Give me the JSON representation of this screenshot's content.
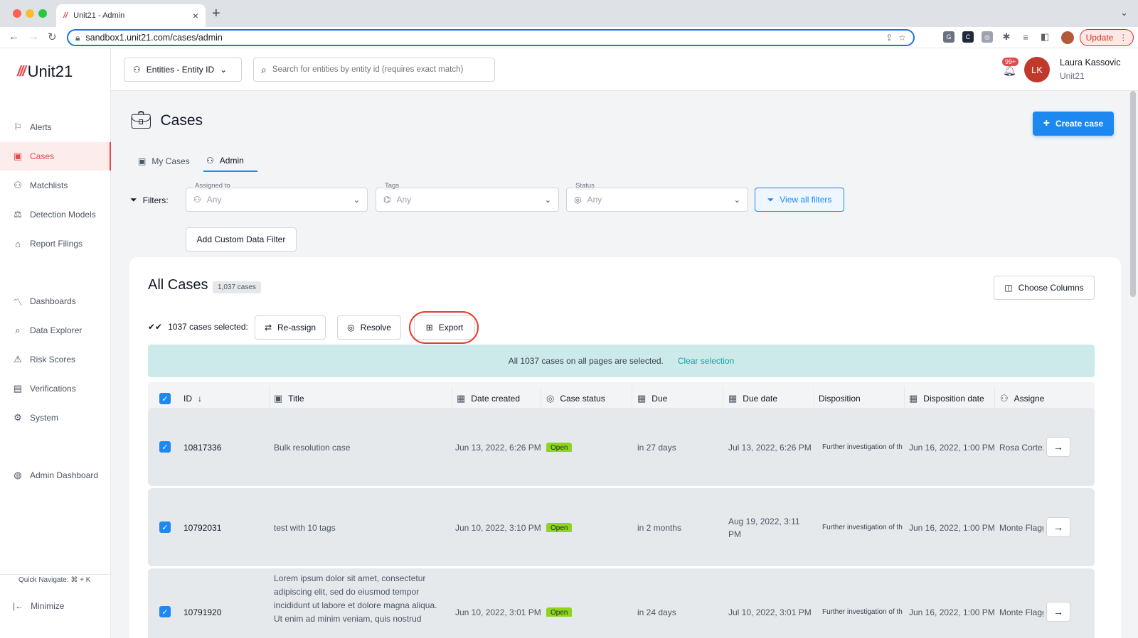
{
  "browser": {
    "tab_title": "Unit21 - Admin",
    "url": "sandbox1.unit21.com/cases/admin",
    "update_label": "Update",
    "new_tab": "+",
    "close_tab": "×"
  },
  "sidebar": {
    "logo_mark": "///",
    "logo_text": "Unit21",
    "items": [
      {
        "label": "Alerts",
        "icon": "flag-icon"
      },
      {
        "label": "Cases",
        "icon": "briefcase-icon"
      },
      {
        "label": "Matchlists",
        "icon": "user-list-icon"
      },
      {
        "label": "Detection Models",
        "icon": "scale-icon"
      },
      {
        "label": "Report Filings",
        "icon": "building-icon"
      },
      {
        "label": "Dashboards",
        "icon": "chart-icon"
      },
      {
        "label": "Data Explorer",
        "icon": "data-explorer-icon"
      },
      {
        "label": "Risk Scores",
        "icon": "warning-icon"
      },
      {
        "label": "Verifications",
        "icon": "id-card-icon"
      },
      {
        "label": "System",
        "icon": "gear-icon"
      },
      {
        "label": "Admin Dashboard",
        "icon": "globe-icon"
      }
    ],
    "active_index": 1,
    "quick_navigate": "Quick Navigate: ⌘ + K",
    "minimize": "Minimize"
  },
  "header": {
    "entity_dropdown": "Entities - Entity ID",
    "search_placeholder": "Search for entities by entity id (requires exact match)",
    "notification_badge": "99+",
    "user_initials": "LK",
    "user_name": "Laura Kassovic",
    "user_org": "Unit21"
  },
  "page": {
    "title": "Cases",
    "create_button": "Create case",
    "tabs": [
      {
        "label": "My Cases"
      },
      {
        "label": "Admin"
      }
    ],
    "active_tab": 1
  },
  "filters": {
    "label": "Filters:",
    "assigned_to": {
      "label": "Assigned to",
      "value": "Any"
    },
    "tags": {
      "label": "Tags",
      "value": "Any"
    },
    "status": {
      "label": "Status",
      "value": "Any"
    },
    "view_all": "View all filters",
    "custom_data": "Add Custom Data Filter"
  },
  "card": {
    "title": "All Cases",
    "count_badge": "1,037 cases",
    "choose_columns": "Choose Columns",
    "selected_label": "1037 cases selected:",
    "reassign": "Re-assign",
    "resolve": "Resolve",
    "export": "Export",
    "banner_text": "All 1037 cases on all pages are selected.",
    "clear_selection": "Clear selection"
  },
  "table": {
    "columns": [
      "ID",
      "Title",
      "Date created",
      "Case status",
      "Due",
      "Due date",
      "Disposition",
      "Disposition date",
      "Assignee"
    ],
    "rows": [
      {
        "id": "10817336",
        "title": "Bulk resolution case",
        "date_created": "Jun 13, 2022, 6:26 PM",
        "status": "Open",
        "due": "in 27 days",
        "due_date": "Jul 13, 2022, 6:26 PM",
        "disposition": "Further investigation of th",
        "disposition_date": "Jun 16, 2022, 1:00 PM",
        "assignee": "Rosa Cortez"
      },
      {
        "id": "10792031",
        "title": "test with 10 tags",
        "date_created": "Jun 10, 2022, 3:10 PM",
        "status": "Open",
        "due": "in 2 months",
        "due_date_line1": "Aug 19, 2022, 3:11",
        "due_date_line2": "PM",
        "disposition": "Further investigation of th",
        "disposition_date": "Jun 16, 2022, 1:00 PM",
        "assignee": "Monte Flagg"
      },
      {
        "id": "10791920",
        "title_lines": [
          "Lorem ipsum dolor sit amet, consectetur",
          "adipiscing elit, sed do eiusmod tempor",
          "incididunt ut labore et dolore magna aliqua.",
          "Ut enim ad minim veniam, quis nostrud"
        ],
        "date_created": "Jun 10, 2022, 3:01 PM",
        "status": "Open",
        "due": "in 24 days",
        "due_date": "Jul 10, 2022, 3:01 PM",
        "disposition": "Further investigation of th",
        "disposition_date": "Jun 16, 2022, 1:00 PM",
        "assignee": "Monte Flagg"
      }
    ]
  },
  "colors": {
    "brand_red": "#e5484d",
    "primary_blue": "#1d89f0",
    "status_open": "#8ed61a",
    "banner_teal": "#cdeaea",
    "highlight_ring": "#ea3a2a"
  }
}
